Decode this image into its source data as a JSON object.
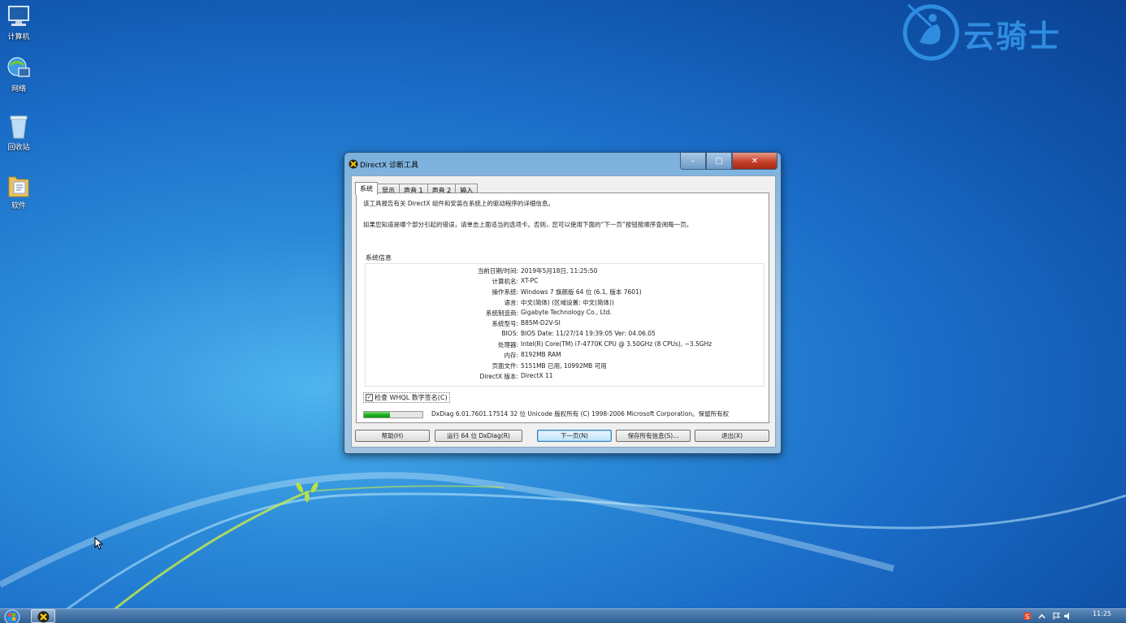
{
  "desktop": {
    "icons": [
      {
        "label": "计算机",
        "icon": "computer-icon"
      },
      {
        "label": "网络",
        "icon": "network-icon"
      },
      {
        "label": "回收站",
        "icon": "recycle-bin-icon"
      },
      {
        "label": "软件",
        "icon": "folder-icon"
      }
    ],
    "watermark": {
      "text": "云骑士",
      "color": "#2f8de0"
    }
  },
  "window": {
    "title": "DirectX 诊断工具",
    "caption_buttons": {
      "minimize": "–",
      "maximize": "□",
      "close": "✕"
    },
    "tabs": [
      {
        "label": "系统",
        "active": true
      },
      {
        "label": "显示",
        "active": false
      },
      {
        "label": "声音 1",
        "active": false
      },
      {
        "label": "声音 2",
        "active": false
      },
      {
        "label": "输入",
        "active": false
      }
    ],
    "intro_line1": "该工具报告有关 DirectX 组件和安装在系统上的驱动程序的详细信息。",
    "intro_line2": "如果您知道是哪个部分引起的错误，请单击上面适当的选项卡。否则，您可以使用下面的“下一页”按钮按顺序查阅每一页。",
    "system_info": {
      "title": "系统信息",
      "rows": [
        {
          "key": "当前日期/时间:",
          "value": "2019年5月18日, 11:25:50"
        },
        {
          "key": "计算机名:",
          "value": "XT-PC"
        },
        {
          "key": "操作系统:",
          "value": "Windows 7 旗舰版 64 位 (6.1, 版本 7601)"
        },
        {
          "key": "语言:",
          "value": "中文(简体) (区域设置: 中文(简体))"
        },
        {
          "key": "系统制造商:",
          "value": "Gigabyte Technology Co., Ltd."
        },
        {
          "key": "系统型号:",
          "value": "B85M-D2V-SI"
        },
        {
          "key": "BIOS:",
          "value": "BIOS Date: 11/27/14 19:39:05 Ver: 04.06.05"
        },
        {
          "key": "处理器:",
          "value": "Intel(R) Core(TM) i7-4770K CPU @ 3.50GHz (8 CPUs), ~3.5GHz"
        },
        {
          "key": "内存:",
          "value": "8192MB RAM"
        },
        {
          "key": "页面文件:",
          "value": "5151MB 已用, 10992MB 可用"
        },
        {
          "key": "DirectX 版本:",
          "value": "DirectX 11"
        }
      ]
    },
    "whql_checkbox": {
      "label": "检查 WHQL 数字签名(C)",
      "checked": true
    },
    "progress_fraction": 0.45,
    "status_text": "DxDiag 6.01.7601.17514 32 位 Unicode 版权所有 (C) 1998-2006 Microsoft Corporation。保留所有权",
    "buttons": {
      "help": "帮助(H)",
      "run64": "运行 64 位 DxDiag(R)",
      "next": "下一页(N)",
      "save": "保存所有信息(S)...",
      "exit": "退出(X)"
    }
  },
  "taskbar": {
    "clock": "11:25",
    "start_icon": "windows-start-icon",
    "running_app_icon": "directx-icon"
  }
}
